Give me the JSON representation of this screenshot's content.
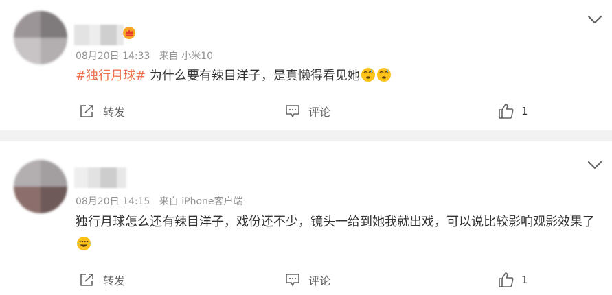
{
  "posts": [
    {
      "time": "08月20日 14:33",
      "source": "来自 小米10",
      "tag": "#独行月球#",
      "text": " 为什么要有辣目洋子，是真懒得看见她",
      "emoji_icons": [
        "cold-sweat-emoji",
        "cold-sweat-emoji"
      ],
      "repost_label": "转发",
      "comment_label": "评论",
      "like_count": "1"
    },
    {
      "time": "08月20日 14:15",
      "source": "来自 iPhone客户端",
      "text": "独行月球怎么还有辣目洋子，戏份还不少，镜头一给到她我就出戏，可以说比较影响观影效果了",
      "emoji_icons": [
        "crying-laughing-emoji"
      ],
      "repost_label": "转发",
      "comment_label": "评论",
      "like_count": "1"
    }
  ],
  "colors": {
    "topic": "#eb7350",
    "meta": "#939393",
    "body_text": "#333333",
    "action_text": "#636363",
    "separator": "#f2f2f2"
  }
}
